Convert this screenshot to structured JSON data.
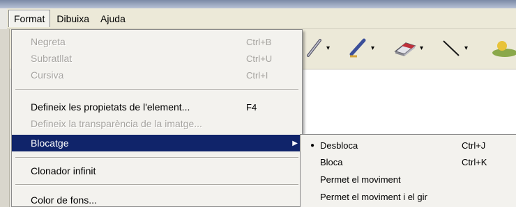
{
  "menubar": {
    "items": [
      {
        "label": "Format"
      },
      {
        "label": "Dibuixa"
      },
      {
        "label": "Ajuda"
      }
    ]
  },
  "format_menu": {
    "items": [
      {
        "label": "Negreta",
        "shortcut": "Ctrl+B",
        "enabled": false
      },
      {
        "label": "Subratllat",
        "shortcut": "Ctrl+U",
        "enabled": false
      },
      {
        "label": "Cursiva",
        "shortcut": "Ctrl+I",
        "enabled": false
      },
      {
        "label": "Defineix les propietats de l'element...",
        "shortcut": "F4",
        "enabled": true
      },
      {
        "label": "Defineix la transparència de la imatge...",
        "shortcut": "",
        "enabled": false
      },
      {
        "label": "Blocatge",
        "shortcut": "",
        "enabled": true,
        "highlighted": true,
        "has_submenu": true
      },
      {
        "label": "Clonador infinit",
        "shortcut": "",
        "enabled": true
      },
      {
        "label": "Color de fons...",
        "shortcut": "",
        "enabled": true
      }
    ]
  },
  "blocatge_submenu": {
    "items": [
      {
        "label": "Desbloca",
        "shortcut": "Ctrl+J",
        "checked": true
      },
      {
        "label": "Bloca",
        "shortcut": "Ctrl+K",
        "checked": false
      },
      {
        "label": "Permet el moviment",
        "shortcut": "",
        "checked": false
      },
      {
        "label": "Permet el moviment i el gir",
        "shortcut": "",
        "checked": false
      }
    ]
  },
  "glyphs": {
    "dropdown_arrow": "▾",
    "submenu_arrow": "▶",
    "bullet": "●"
  },
  "toolbar": {
    "tools": [
      {
        "icon": "pen-icon"
      },
      {
        "icon": "highlighter-icon"
      },
      {
        "icon": "eraser-icon"
      },
      {
        "icon": "line-icon"
      },
      {
        "icon": "fill-icon"
      }
    ]
  }
}
